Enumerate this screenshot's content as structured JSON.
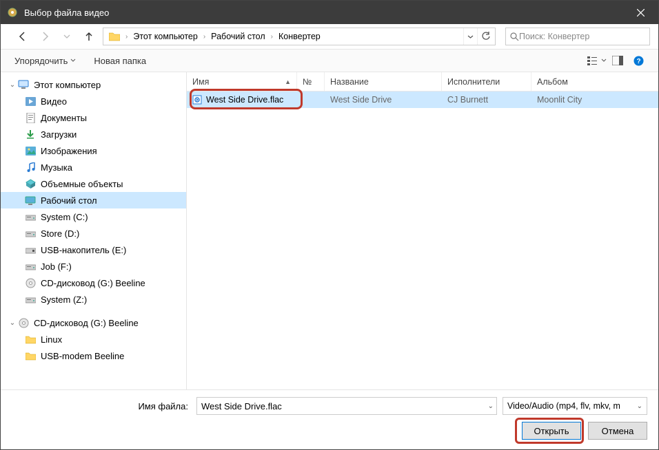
{
  "window": {
    "title": "Выбор файла видео"
  },
  "nav": {
    "breadcrumb": [
      "Этот компьютер",
      "Рабочий стол",
      "Конвертер"
    ],
    "search_placeholder": "Поиск: Конвертер"
  },
  "toolbar": {
    "organize": "Упорядочить",
    "new_folder": "Новая папка"
  },
  "sidebar": {
    "root_label": "Этот компьютер",
    "items": [
      {
        "label": "Видео",
        "icon": "video"
      },
      {
        "label": "Документы",
        "icon": "doc"
      },
      {
        "label": "Загрузки",
        "icon": "download"
      },
      {
        "label": "Изображения",
        "icon": "image"
      },
      {
        "label": "Музыка",
        "icon": "music"
      },
      {
        "label": "Объемные объекты",
        "icon": "3d"
      },
      {
        "label": "Рабочий стол",
        "icon": "desktop",
        "selected": true
      },
      {
        "label": "System (C:)",
        "icon": "drive"
      },
      {
        "label": "Store (D:)",
        "icon": "drive"
      },
      {
        "label": "USB-накопитель (E:)",
        "icon": "usb"
      },
      {
        "label": "Job (F:)",
        "icon": "drive"
      },
      {
        "label": "CD-дисковод (G:) Beeline",
        "icon": "cd"
      },
      {
        "label": "System (Z:)",
        "icon": "drive"
      }
    ],
    "root2_label": "CD-дисковод (G:) Beeline",
    "root2_items": [
      {
        "label": "Linux",
        "icon": "folder"
      },
      {
        "label": "USB-modem Beeline",
        "icon": "folder"
      }
    ]
  },
  "columns": {
    "name": "Имя",
    "num": "№",
    "title": "Название",
    "artist": "Исполнители",
    "album": "Альбом"
  },
  "files": [
    {
      "name": "West Side Drive.flac",
      "num": "",
      "title": "West Side Drive",
      "artist": "CJ Burnett",
      "album": "Moonlit City",
      "selected": true
    }
  ],
  "footer": {
    "filename_label": "Имя файла:",
    "filename_value": "West Side Drive.flac",
    "filter": "Video/Audio (mp4, flv, mkv, m",
    "open": "Открыть",
    "cancel": "Отмена"
  }
}
